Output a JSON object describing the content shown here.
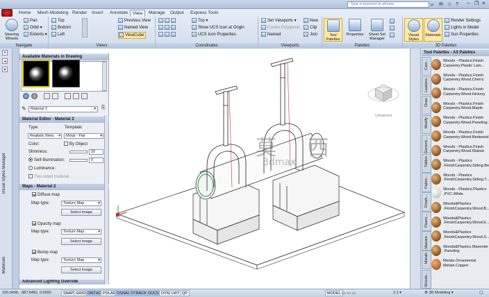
{
  "app": {
    "search_placeholder": "Type a keyword or phrase"
  },
  "ribbon": {
    "tabs": [
      "Home",
      "Mesh Modeling",
      "Render",
      "Insert",
      "Annotate",
      "View",
      "Manage",
      "Output",
      "Express Tools"
    ],
    "active_tab": "View",
    "navigate": {
      "title": "Navigate",
      "steering": "Steering Wheels",
      "pan": "Pan",
      "orbit": "Orbit",
      "extents": "Extents"
    },
    "views": {
      "title": "Views",
      "top": "Top",
      "bottom": "Bottom",
      "left": "Left",
      "previous": "Previous View",
      "named": "Named View",
      "viewcube": "ViewCube"
    },
    "coordinates": {
      "title": "Coordinates",
      "top": "Top",
      "show_ucs": "Show UCS Icon at Origin",
      "ucs_props": "UCS Icon Properties"
    },
    "viewports": {
      "title": "Viewports",
      "set": "Set Viewports",
      "create_polygonal": "Create Polygonal",
      "named": "Named",
      "new": "New",
      "clip": "Clip",
      "join": "Join"
    },
    "palettes": {
      "title": "Palettes",
      "tool": "Tool Palettes",
      "properties": "Properties",
      "sheet_set": "Sheet Set Manager"
    },
    "palettes3d": {
      "title": "3D Palettes",
      "visual_styles": "Visual Styles",
      "materials": "Materials",
      "render_settings": "Render Settings",
      "lights_in_model": "Lights in Model",
      "sun_properties": "Sun Properties"
    }
  },
  "leftbar": {
    "visual_styles_manager": "Visual Styles Manager",
    "materials": "Materials"
  },
  "materials_palette": {
    "available_header": "Available Materials in Drawing",
    "material_select": "Material 2",
    "editor_header": "Material Editor - Material 2",
    "type_label": "Type:",
    "type_value": "Realistic Meta",
    "template_label": "Template:",
    "template_value": "Metal - Flat",
    "color_label": "Color:",
    "by_object": "By Object",
    "shininess_label": "Shininess:",
    "shininess_value": "20",
    "self_illum_label": "Self-Illumination:",
    "self_illum_value": "0",
    "luminance_label": "Luminance:",
    "two_sided": "Two-sided material",
    "maps_header": "Maps - Material 2",
    "diffuse_map": "Diffuse map",
    "opacity_map": "Opacity map",
    "bump_map": "Bump map",
    "map_type_label": "Map type:",
    "map_type_value": "Texture Map",
    "select_image": "Select Image",
    "adv_header": "Advanced Lighting Override"
  },
  "viewport": {
    "viewcube_label": "Unnamed",
    "watermark_chars": "莫 西",
    "watermark_url": "3dmax"
  },
  "tool_palettes": {
    "header": "Tool Palettes - All Palettes",
    "tabs": [
      "Cam...",
      "Leaders",
      "Draw",
      "Modify",
      "Generic...",
      "Tables",
      "Fabric...",
      "Finish...",
      "Floors...",
      "Masonr...",
      "Metals",
      "Woods..."
    ],
    "items": [
      "Woods - Plastics.Finish Carpentry.Plastic Lam...",
      "Woods - Plastics.Finish Carpentry.Wood.Cherry",
      "Woods - Plastics.Finish Carpentry.Wood.Hickory",
      "Woods - Plastics.Finish Carpentry.Wood.Maple",
      "Woods - Plastics.Finish Carpentry.Wood.Paneling.1",
      "Woods - Plastics.Finish Carpentry.Wood.Redwood",
      "Woods - Plastics.Finish Carpentry.Wood.Walnut",
      "Woods - Plastics .FinishCarpentry.Siding.Be...",
      "Woods - Plastics .FinishCarpentry.Siding.T...",
      "Woods - Plastics.Plastics .PVC.White",
      "Woods&Plastics .FinishCarpentry.Wood.B...",
      "Woods&Plastics .FinishCarpentry.Wood.E...",
      "Woods&Plastics .FinishCarpentry.Wood.S...",
      "Woods&Plastics.Masonite .Paneling",
      "Metals.Ornamental Metals.Copper"
    ]
  },
  "statusbar": {
    "coords": "100.0496, -387.6482, 0.0000",
    "toggles": [
      "SNAP",
      "GRID",
      "ORTHO",
      "POLAR",
      "OSNAP",
      "OTRACK",
      "DUCS",
      "DYN",
      "LWT",
      "QP"
    ],
    "toggles_on": [
      "ORTHO",
      "OSNAP",
      "OTRACK",
      "DUCS"
    ],
    "model": "MODEL",
    "scale": "1:1",
    "workspace": "3D Modeling"
  },
  "colors": {
    "ribbon_bg": "#dce6f2",
    "accent": "#3a6ea5"
  }
}
